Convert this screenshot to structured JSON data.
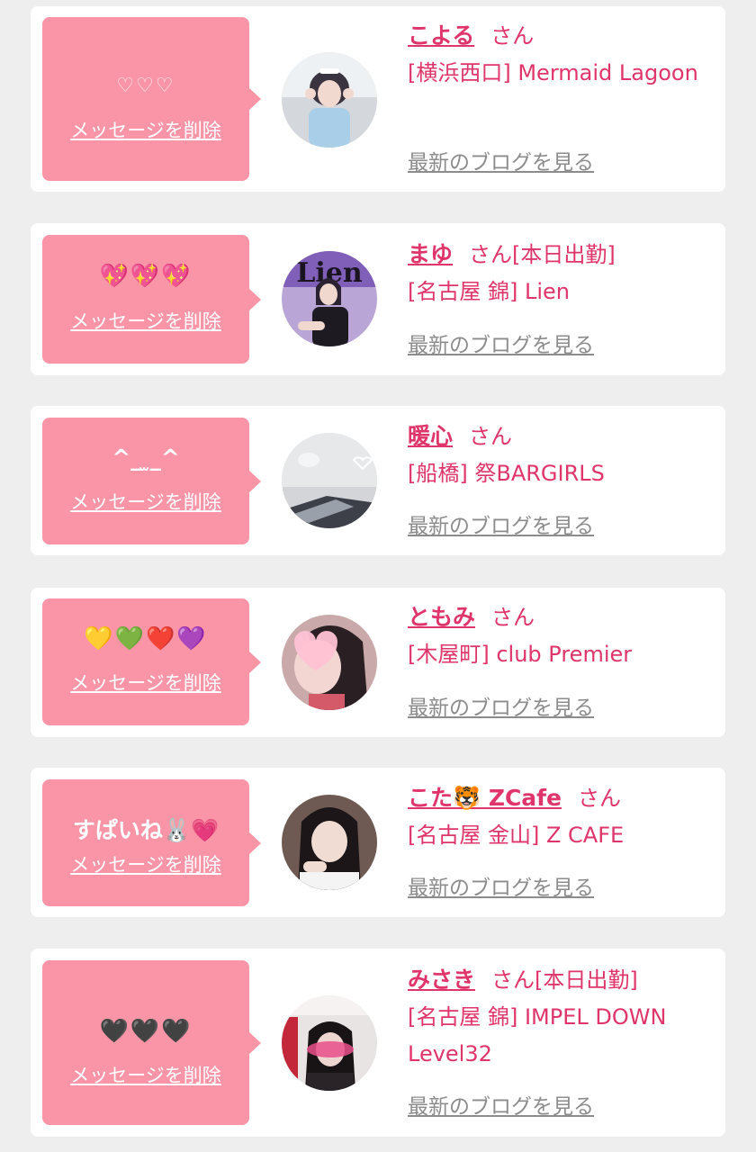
{
  "common": {
    "delete_label": "メッセージを削除",
    "san": "さん",
    "blog_label": "最新のブログを見る"
  },
  "cards": [
    {
      "message": "♡♡♡",
      "name": "こよる",
      "status": "",
      "shop": "[横浜西口] Mermaid Lagoon"
    },
    {
      "message": "💖💖💖",
      "name": "まゆ",
      "status": "[本日出勤]",
      "shop": "[名古屋 錦] Lien"
    },
    {
      "message": "^_ ̫_^",
      "name": "暖心",
      "status": "",
      "shop": "[船橋] 祭BARGIRLS"
    },
    {
      "message": "💛💚❤️💜",
      "name": "ともみ",
      "status": "",
      "shop": "[木屋町] club Premier"
    },
    {
      "message": "すぱいね🐰💗",
      "name": "こた🐯 ZCafe",
      "status": "",
      "shop": "[名古屋 金山] Z CAFE"
    },
    {
      "message": "🖤🖤🖤",
      "name": "みさき",
      "status": "[本日出勤]",
      "shop": "[名古屋 錦] IMPEL DOWN Level32"
    }
  ],
  "avatars": {
    "2": {
      "overlay_text": "Lien"
    }
  },
  "colors": {
    "bubble": "#f995a6",
    "accent": "#e0356a",
    "link_gray": "#8c8c8c",
    "background": "#eeeeee"
  }
}
